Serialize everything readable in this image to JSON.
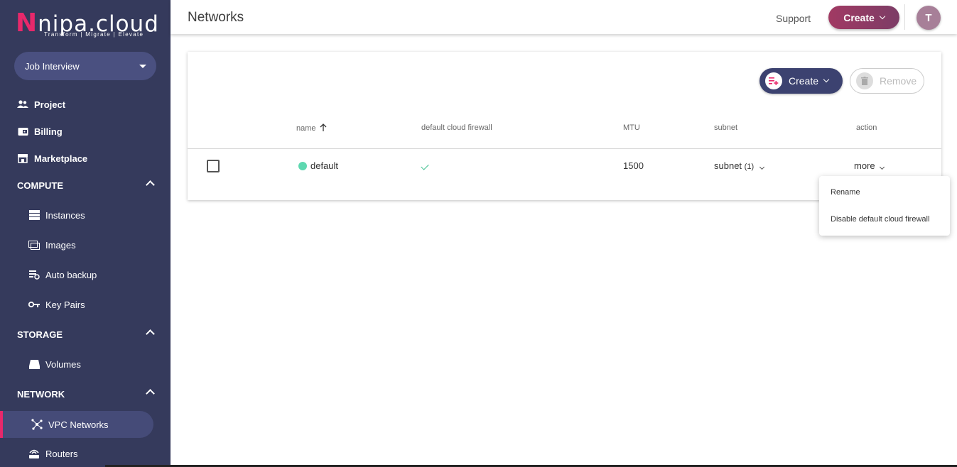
{
  "brand": {
    "name_first": "N",
    "name_rest": "nipa.cloud",
    "tagline": "Transform | Migrate | Elevate"
  },
  "project_selector": {
    "value": "Job Interview"
  },
  "sidebar": {
    "top_items": [
      {
        "label": "Project",
        "icon": "users-icon"
      },
      {
        "label": "Billing",
        "icon": "wallet-icon"
      },
      {
        "label": "Marketplace",
        "icon": "store-icon"
      }
    ],
    "sections": [
      {
        "label": "COMPUTE",
        "items": [
          {
            "label": "Instances",
            "icon": "server-icon"
          },
          {
            "label": "Images",
            "icon": "image-icon"
          },
          {
            "label": "Auto backup",
            "icon": "backup-icon"
          },
          {
            "label": "Key Pairs",
            "icon": "key-icon"
          }
        ]
      },
      {
        "label": "STORAGE",
        "items": [
          {
            "label": "Volumes",
            "icon": "disk-icon"
          }
        ]
      },
      {
        "label": "NETWORK",
        "items": [
          {
            "label": "VPC Networks",
            "icon": "network-icon",
            "active": true
          },
          {
            "label": "Routers",
            "icon": "router-icon"
          }
        ]
      }
    ]
  },
  "header": {
    "title": "Networks",
    "support": "Support",
    "create": "Create",
    "avatar_initial": "T"
  },
  "toolbar": {
    "create": "Create",
    "remove": "Remove"
  },
  "table": {
    "columns": [
      "name",
      "default cloud firewall",
      "MTU",
      "subnet",
      "action"
    ],
    "sort": {
      "column": "name",
      "direction": "asc"
    },
    "rows": [
      {
        "name": "default",
        "status_color": "#5ed8b0",
        "default_firewall": true,
        "mtu": "1500",
        "subnet": "subnet",
        "subnet_count": "(1)",
        "action": "more"
      }
    ]
  },
  "action_menu": {
    "items": [
      "Rename",
      "Disable default cloud firewall"
    ]
  },
  "colors": {
    "sidebar": "#353a5c",
    "accent": "#e8286b",
    "primary_button": "#3c4270",
    "header_create": "#9b3a64"
  }
}
